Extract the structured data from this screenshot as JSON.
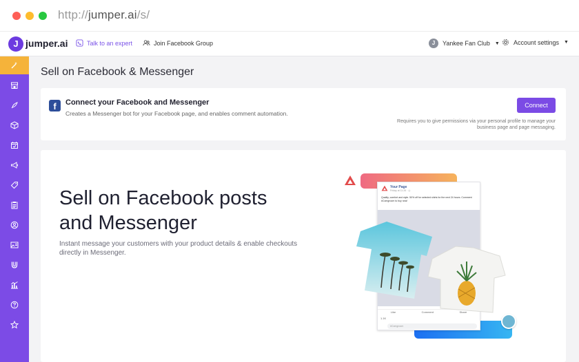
{
  "browser": {
    "url_scheme": "http://",
    "url_host": "jumper.ai",
    "url_path": "/s/"
  },
  "header": {
    "logo_letter": "J",
    "brand": "jumper.ai",
    "talk_expert": "Talk to an expert",
    "join_group": "Join Facebook Group",
    "club_avatar_letter": "J",
    "club_name": "Yankee Fan Club",
    "account_settings": "Account settings"
  },
  "sidebar": {
    "expander_glyph": "»",
    "items": [
      {
        "icon": "magic-wand-icon",
        "active": true
      },
      {
        "icon": "store-icon",
        "active": false
      },
      {
        "icon": "rocket-icon",
        "active": false
      },
      {
        "icon": "box-icon",
        "active": false
      },
      {
        "icon": "calendar-check-icon",
        "active": false
      },
      {
        "icon": "megaphone-icon",
        "active": false
      },
      {
        "icon": "tag-icon",
        "active": false
      },
      {
        "icon": "clipboard-icon",
        "active": false
      },
      {
        "icon": "user-circle-icon",
        "active": false
      },
      {
        "icon": "image-text-icon",
        "active": false
      },
      {
        "icon": "magnet-icon",
        "active": false
      },
      {
        "icon": "analytics-icon",
        "active": false
      },
      {
        "icon": "help-icon",
        "active": false
      },
      {
        "icon": "star-icon",
        "active": false
      }
    ]
  },
  "main": {
    "page_title": "Sell on Facebook & Messenger",
    "connect_card": {
      "fb_letter": "f",
      "title": "Connect your Facebook and Messenger",
      "description": "Creates a Messenger bot for your Facebook page, and enables comment automation.",
      "button": "Connect",
      "note": "Requires you to give permissions via your personal profile to manage your business page and page messaging."
    },
    "hero": {
      "title": "Sell on Facebook posts and Messenger",
      "subtitle": "Instant message your customers with your product details & enable checkouts directly in Messenger."
    },
    "post": {
      "page_name": "Your Page",
      "sub": "Friday at 11:26 · ◎",
      "text": "Quality, comfort and style. 50% off for selected shirts for the next 24 hours. Comment #Comgroom to buy now!",
      "like": "Like",
      "comment": "Comment",
      "share": "Share",
      "count": "1.1K",
      "comment_placeholder": "#Comgroom"
    }
  },
  "colors": {
    "primary": "#7c4be6",
    "active": "#f5b33a",
    "facebook": "#2d4e9a"
  }
}
